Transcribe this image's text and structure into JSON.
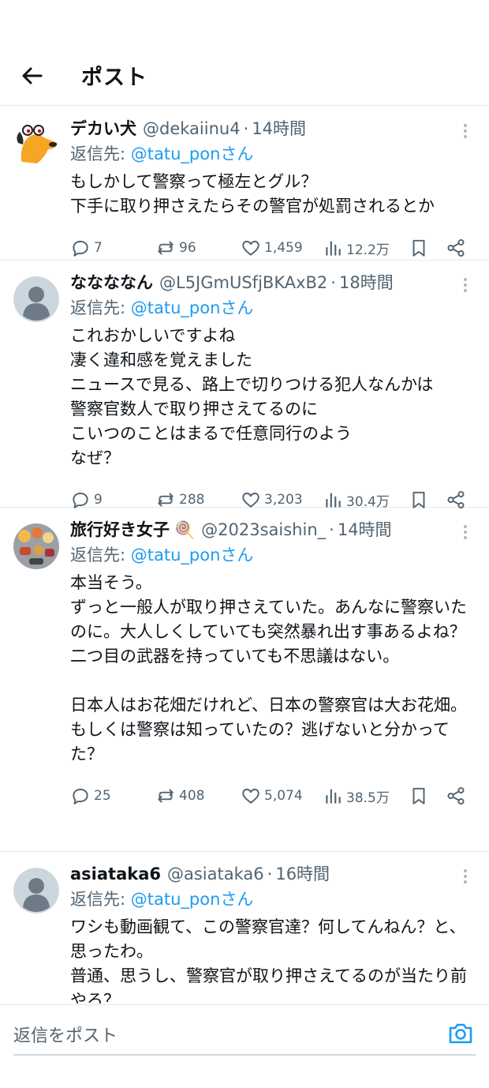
{
  "header": {
    "title": "ポスト"
  },
  "colors": {
    "accent": "#1d9bf0",
    "secondary_text": "#536471",
    "divider": "#e7e9ea"
  },
  "tweets": [
    {
      "name": "デカい犬",
      "handle": "@dekaiinu4",
      "time": "14時間",
      "reply_prefix": "返信先:",
      "reply_to": "@tatu_ponさん",
      "text": "もしかして警察って極左とグル？\n下手に取り押さえたらその警官が処罰されるとか",
      "replies": "7",
      "retweets": "96",
      "likes": "1,459",
      "views": "12.2万",
      "avatar": "yellow-cartoon-dog"
    },
    {
      "name": "ななななん",
      "handle": "@L5JGmUSfjBKAxB2",
      "time": "18時間",
      "reply_prefix": "返信先:",
      "reply_to": "@tatu_ponさん",
      "text": "これおかしいですよね\n凄く違和感を覚えました\nニュースで見る、路上で切りつける犯人なんかは\n警察官数人で取り押さえてるのに\nこいつのことはまるで任意同行のよう\nなぜ？",
      "replies": "9",
      "retweets": "288",
      "likes": "3,203",
      "views": "30.4万",
      "avatar": "default-person"
    },
    {
      "name": "旅行好き女子",
      "name_emoji": "🍭",
      "handle": "@2023saishin_",
      "time": "14時間",
      "reply_prefix": "返信先:",
      "reply_to": "@tatu_ponさん",
      "text": "本当そう。\nずっと一般人が取り押さえていた。あんなに警察いたのに。大人しくしていても突然暴れ出す事あるよね？\n二つ目の武器を持っていても不思議はない。\n\n日本人はお花畑だけれど、日本の警察官は大お花畑。\nもしくは警察は知っていたの？逃げないと分かってた？",
      "replies": "25",
      "retweets": "408",
      "likes": "5,074",
      "views": "38.5万",
      "avatar": "food-photo"
    },
    {
      "name": "asiataka6",
      "handle": "@asiataka6",
      "time": "16時間",
      "reply_prefix": "返信先:",
      "reply_to": "@tatu_ponさん",
      "text": "ワシも動画観て、この警察官達？何してんねん？と、思ったわ。\n普通、思うし、警察官が取り押さえてるのが当たり前やろ？",
      "replies": "",
      "retweets": "",
      "likes": "",
      "views": "",
      "avatar": "default-person"
    }
  ],
  "reply_bar": {
    "placeholder": "返信をポスト"
  }
}
